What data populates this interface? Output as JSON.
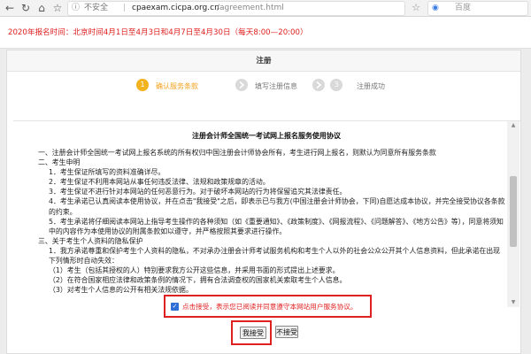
{
  "browser": {
    "address": {
      "security_text": "不安全",
      "host": "cpaexam.cicpa.org.cn",
      "path": "/agreement.html"
    },
    "search": {
      "engine": "百度"
    }
  },
  "notice": {
    "text": "2020年报名时间：北京时间4月1日至4月3日和4月7日至4月30日（每天8:00—20:00）"
  },
  "panel": {
    "title": "注册"
  },
  "steps": [
    {
      "number": "1",
      "label": "确认服务条款",
      "active": true
    },
    {
      "number": "2",
      "label": "填写注册信息",
      "active": false
    },
    {
      "number": "3",
      "label": "注册成功",
      "active": false
    }
  ],
  "agreement": {
    "title": "注册会计师全国统一考试网上报名服务使用协议",
    "paragraphs": [
      "一、注册会计师全国统一考试网上报名系统的所有权归中国注册会计师协会所有，考生进行网上报名，则默认为同意所有服务条款",
      "二、考生申明",
      "1．考生保证所填写的资料准确详尽。",
      "2．考生保证不利用本网站从事任何违反法律、法规和政策规章的活动。",
      "3．考生保证不进行针对本网站的任何恶意行为。对于破坏本网站的行为将保留追究其法律责任。",
      "4．考生承诺已认真阅读本使用协议，并在点击\"我接受\"之后，即表示已与我方(中国注册会计师协会，下同)自愿达成本协议，并完全接受协议各条款的约束。",
      "5．考生承诺将仔细阅读本网站上指导考生操作的各种须知（如《重要通知》、《政策制度》、《网报流程》、《问题解答》、《地方公告》等），同意将须知中的内容作为本使用协议的附属条款如以遵守，并严格按照其要求进行操作。",
      "三、关于考生个人资料的隐私保护",
      "1．我方承诺尊重和保护考生个人资料的隐私，不对承办注册会计师考试服务机构和考生个人以外的社会公众公开其个人信息资料，但此承诺在出现下列情形时自动失效：",
      "（1）考生（包括其授权的人）特别要求我方公开这些信息，并采用书面的形式提出上述要求。",
      "（2）在符合国家相应法律和政策条例的情况下，拥有合法调查权的国家机关索取考生个人信息。",
      "（3）对考生个人信息的公开有相关法规依据。"
    ]
  },
  "consent": {
    "checked": true,
    "text": "点击接受，表示您已阅读并同意遵守本网站用户服务协议。"
  },
  "buttons": {
    "accept": "我接受",
    "decline": "不接受"
  },
  "colors": {
    "accent": "#f3b31e",
    "alert": "#e02020",
    "checkbox": "#2f6fd6"
  }
}
